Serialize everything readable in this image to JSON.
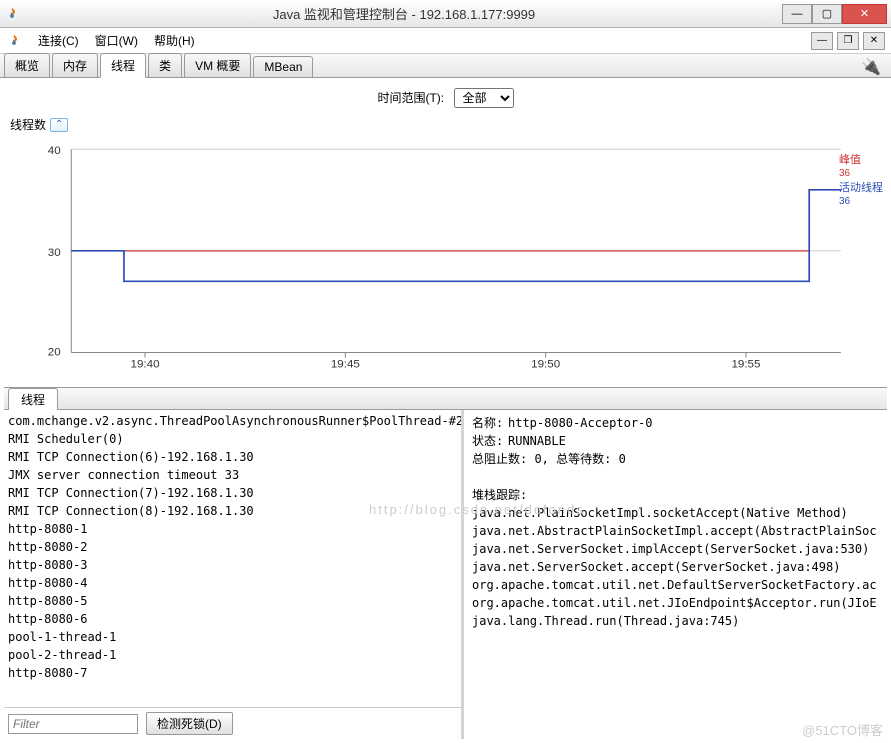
{
  "titlebar": {
    "title": "Java 监视和管理控制台 - 192.168.1.177:9999"
  },
  "menubar": {
    "connect": "连接(C)",
    "window": "窗口(W)",
    "help": "帮助(H)"
  },
  "tabs": {
    "overview": "概览",
    "memory": "内存",
    "threads": "线程",
    "classes": "类",
    "vm": "VM 概要",
    "mbean": "MBean"
  },
  "time_range": {
    "label": "时间范围(T):",
    "value": "全部"
  },
  "chart": {
    "title": "线程数",
    "y_ticks": [
      "40",
      "30",
      "20"
    ],
    "x_ticks": [
      "19:40",
      "19:45",
      "19:50",
      "19:55"
    ],
    "legend": {
      "peak_label": "峰值",
      "peak_value": "36",
      "active_label": "活动线程",
      "active_value": "36"
    }
  },
  "chart_data": {
    "type": "line",
    "xlabel": "",
    "ylabel": "",
    "ylim": [
      20,
      40
    ],
    "x": [
      "19:38",
      "19:39",
      "19:40",
      "19:41",
      "19:42",
      "19:45",
      "19:50",
      "19:55",
      "19:56.6",
      "19:57"
    ],
    "series": [
      {
        "name": "峰值",
        "color": "#cc3333",
        "values": [
          30,
          30,
          30,
          30,
          30,
          30,
          30,
          30,
          30,
          36
        ]
      },
      {
        "name": "活动线程",
        "color": "#2a4db5",
        "values": [
          30,
          30,
          30,
          27,
          27,
          27,
          27,
          27,
          27,
          36
        ]
      }
    ]
  },
  "bottom_tab": {
    "label": "线程"
  },
  "threads": [
    "com.mchange.v2.async.ThreadPoolAsynchronousRunner$PoolThread-#2",
    "RMI Scheduler(0)",
    "RMI TCP Connection(6)-192.168.1.30",
    "JMX server connection timeout 33",
    "RMI TCP Connection(7)-192.168.1.30",
    "RMI TCP Connection(8)-192.168.1.30",
    "http-8080-1",
    "http-8080-2",
    "http-8080-3",
    "http-8080-4",
    "http-8080-5",
    "http-8080-6",
    "pool-1-thread-1",
    "pool-2-thread-1",
    "http-8080-7"
  ],
  "filter": {
    "placeholder": "Filter",
    "detect_btn": "检测死锁(D)"
  },
  "detail": {
    "name_label": "名称:",
    "name_value": "http-8080-Acceptor-0",
    "state_label": "状态:",
    "state_value": "RUNNABLE",
    "blocked_label": "总阻止数:",
    "blocked_value": "0,",
    "waited_label": "总等待数:",
    "waited_value": "0",
    "stack_label": "堆栈跟踪:",
    "stack": [
      "java.net.PlainSocketImpl.socketAccept(Native Method)",
      "java.net.AbstractPlainSocketImpl.accept(AbstractPlainSoc",
      "java.net.ServerSocket.implAccept(ServerSocket.java:530)",
      "java.net.ServerSocket.accept(ServerSocket.java:498)",
      "org.apache.tomcat.util.net.DefaultServerSocketFactory.ac",
      "org.apache.tomcat.util.net.JIoEndpoint$Acceptor.run(JIoE",
      "java.lang.Thread.run(Thread.java:745)"
    ]
  },
  "watermark1": "http://blog.csdn.net/defonds",
  "watermark2": "@51CTO博客"
}
